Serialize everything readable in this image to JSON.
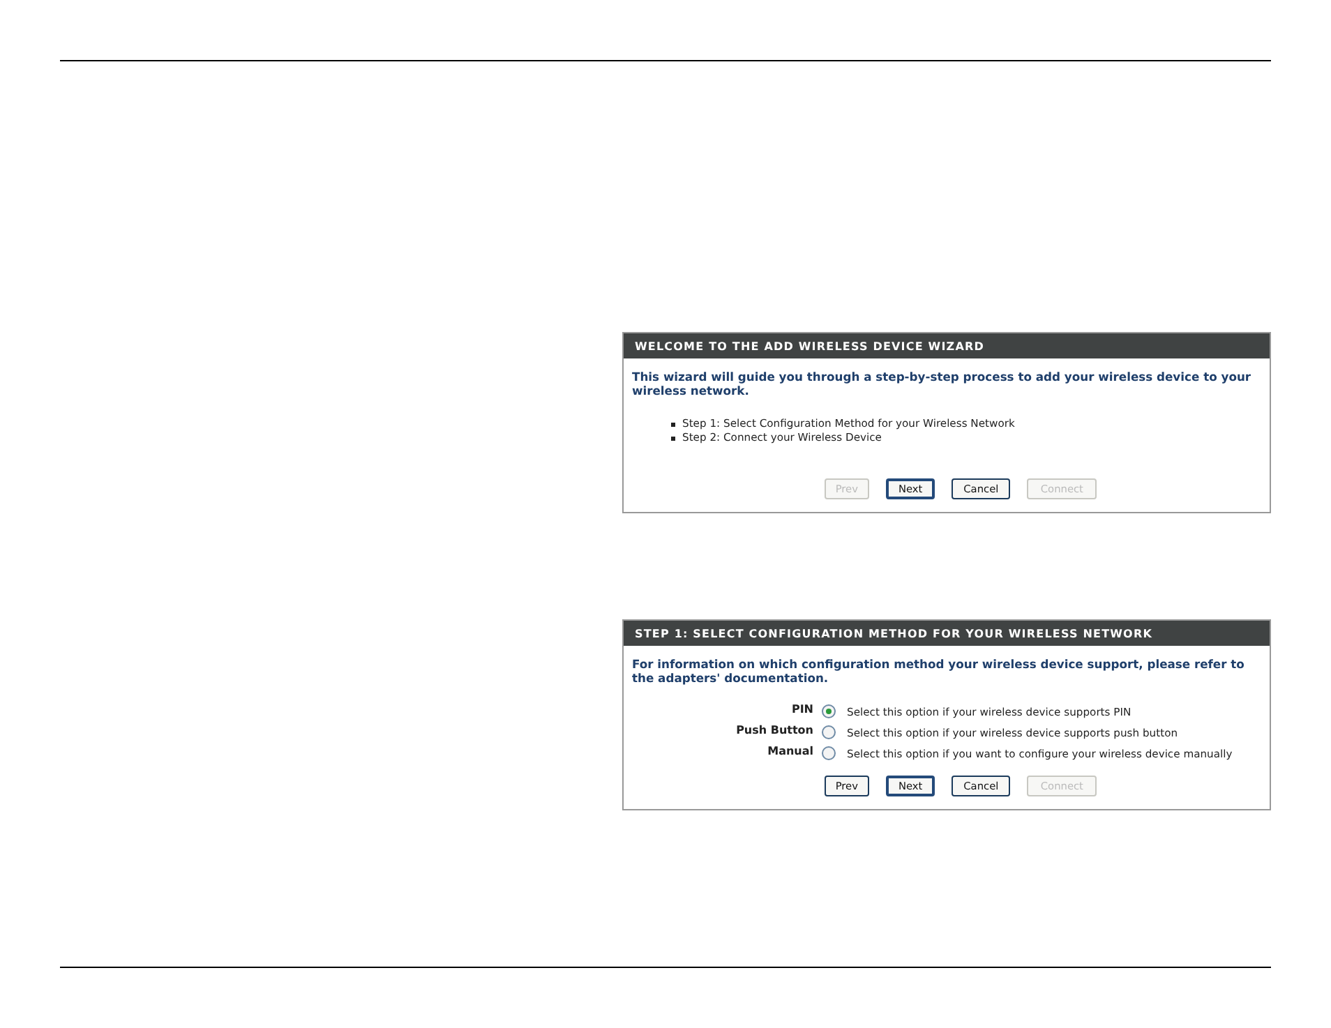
{
  "panels": [
    {
      "title": "WELCOME TO THE ADD WIRELESS DEVICE WIZARD",
      "intro": "This wizard will guide you through a step-by-step process to add your wireless device to your wireless network.",
      "steps": [
        "Step 1: Select Configuration Method for your Wireless Network",
        "Step 2: Connect your Wireless Device"
      ],
      "buttons": [
        {
          "label": "Prev",
          "disabled": true,
          "focused": false
        },
        {
          "label": "Next",
          "disabled": false,
          "focused": true
        },
        {
          "label": "Cancel",
          "disabled": false,
          "focused": false
        },
        {
          "label": "Connect",
          "disabled": true,
          "focused": false
        }
      ]
    },
    {
      "title": "STEP 1: SELECT CONFIGURATION METHOD FOR YOUR WIRELESS NETWORK",
      "intro": "For information on which configuration method your wireless device support, please refer to the adapters' documentation.",
      "options": [
        {
          "label": "PIN",
          "description": "Select this option if your wireless device supports PIN",
          "selected": true
        },
        {
          "label": "Push Button",
          "description": "Select this option if your wireless device supports push button",
          "selected": false
        },
        {
          "label": "Manual",
          "description": "Select this option if you want to configure your wireless device manually",
          "selected": false
        }
      ],
      "buttons": [
        {
          "label": "Prev",
          "disabled": false,
          "focused": false
        },
        {
          "label": "Next",
          "disabled": false,
          "focused": true
        },
        {
          "label": "Cancel",
          "disabled": false,
          "focused": false
        },
        {
          "label": "Connect",
          "disabled": true,
          "focused": false
        }
      ]
    }
  ]
}
